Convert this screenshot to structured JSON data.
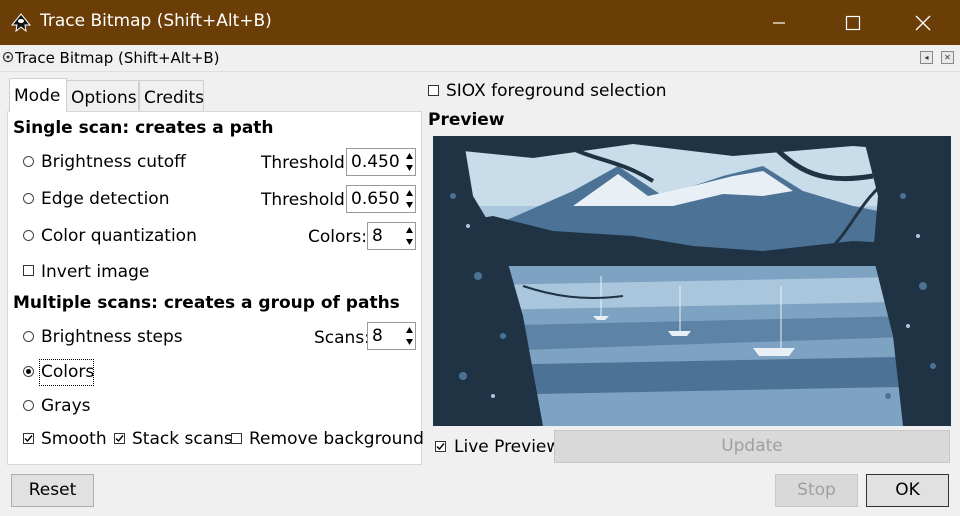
{
  "window": {
    "title": "Trace Bitmap (Shift+Alt+B)"
  },
  "dock": {
    "title": "Trace Bitmap (Shift+Alt+B)"
  },
  "tabs": [
    {
      "label": "Mode"
    },
    {
      "label": "Options"
    },
    {
      "label": "Credits"
    }
  ],
  "single_scan": {
    "heading": "Single scan: creates a path",
    "brightness": {
      "label": "Brightness cutoff",
      "param_label": "Threshold:",
      "value": "0.450"
    },
    "edge": {
      "label": "Edge detection",
      "param_label": "Threshold:",
      "value": "0.650"
    },
    "color_quant": {
      "label": "Color quantization",
      "param_label": "Colors:",
      "value": "8"
    },
    "invert": {
      "label": "Invert image",
      "checked": false
    }
  },
  "multi_scan": {
    "heading": "Multiple scans: creates a group of paths",
    "brightness_steps": {
      "label": "Brightness steps",
      "param_label": "Scans:",
      "value": "8"
    },
    "colors": {
      "label": "Colors",
      "selected": true
    },
    "grays": {
      "label": "Grays"
    },
    "smooth": {
      "label": "Smooth",
      "checked": true
    },
    "stack": {
      "label": "Stack scans",
      "checked": true
    },
    "remove_bg": {
      "label": "Remove background",
      "checked": false
    }
  },
  "siox": {
    "label": "SIOX foreground selection",
    "checked": false
  },
  "preview": {
    "heading": "Preview",
    "live_label": "Live Preview",
    "live_checked": true,
    "update_label": "Update"
  },
  "buttons": {
    "reset": "Reset",
    "stop": "Stop",
    "ok": "OK"
  },
  "colors": {
    "titlebar": "#6b3e07",
    "preview_dark": "#1f3345",
    "preview_mid": "#4c7396",
    "preview_light": "#a9c6dd"
  }
}
